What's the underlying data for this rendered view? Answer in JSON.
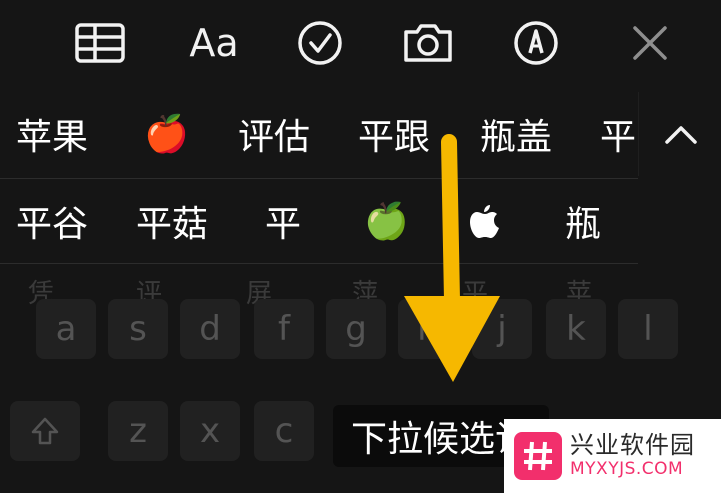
{
  "toolbar": {
    "icons": [
      "table-icon",
      "text-format-icon",
      "checklist-icon",
      "camera-icon",
      "markup-icon",
      "close-icon"
    ],
    "format_label": "Aa"
  },
  "candidates": {
    "row1": [
      "苹果",
      "🍎",
      "评估",
      "平跟",
      "瓶盖",
      "平"
    ],
    "row2": [
      "平谷",
      "平菇",
      "平",
      "🍏",
      "",
      "瓶"
    ]
  },
  "keyboard": {
    "ghost_candidates": [
      "凭",
      "评",
      "屏",
      "萍",
      "平",
      "苹"
    ],
    "row_keys": [
      "a",
      "s",
      "d",
      "f",
      "g",
      "h",
      "j",
      "k",
      "l"
    ],
    "bottom_keys": [
      "z",
      "x",
      "c"
    ]
  },
  "caption": {
    "text": "下拉候选词"
  },
  "watermark": {
    "title": "兴业软件园",
    "url": "MYXYJS.COM"
  },
  "colors": {
    "arrow": "#f6b800",
    "watermark_accent": "#f22f6c"
  }
}
